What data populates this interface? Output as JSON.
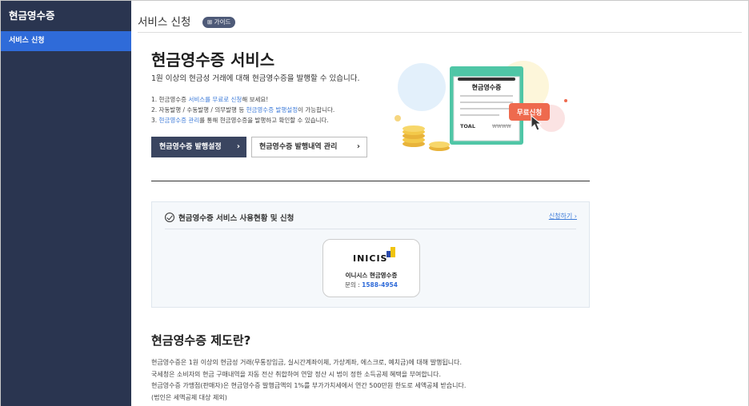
{
  "sidebar": {
    "title": "현금영수증",
    "items": [
      {
        "label": "서비스 신청"
      }
    ]
  },
  "header": {
    "title": "서비스 신청",
    "guide_badge": "⊞ 가이드"
  },
  "hero": {
    "title": "현금영수증 서비스",
    "subtitle": "1원 이상의 현금성 거래에 대해 현금영수증을 발행할 수 있습니다.",
    "lines": [
      {
        "pre": "1. 현금영수증 ",
        "hl": "서비스를 무료로 신청",
        "post": "해 보세요!"
      },
      {
        "pre": "2. 자동발행 / 수동발행 / 의무발행 등 ",
        "hl": "현금영수증 발행설정",
        "post": "이 가능합니다."
      },
      {
        "pre": "3. ",
        "hl": "현금영수증 관리",
        "post": "를 통해 현금영수증을 발행하고 확인할 수 있습니다."
      }
    ],
    "btn_primary": "현금영수증 발행설정",
    "btn_secondary": "현금영수증 발행내역 관리",
    "chevron": "›"
  },
  "illustration": {
    "receipt_title": "현금영수증",
    "total_label": "TOAL",
    "total_value": "₩₩₩₩",
    "badge": "무료신청"
  },
  "status": {
    "heading": "현금영수증 서비스 사용현황 및 신청",
    "apply_link": "신청하기 ›",
    "card": {
      "logo": "INICIS",
      "name": "이니시스 현금영수증",
      "phone_label": "문의 : ",
      "phone": "1588-4954"
    }
  },
  "section": {
    "title": "현금영수증 제도란?",
    "lines": [
      "현금영수증은 1원 이상의 현금성 거래(무통장입금, 실시간계좌이체, 가상계좌, 에스크로, 예치금)에 대해 발행됩니다.",
      "국세청은 소비자의 현금 구매내역을 자동 전산 취합하여 연말 정산 시 법이 정한 소득공제 혜택을 부여합니다.",
      "현금영수증 가맹점(판매자)은 현금영수증 발행금액의 1%를 부가가치세에서 연간 500만원 한도로 세액공제 받습니다.",
      "(법인은 세액공제 대상 제외)"
    ]
  },
  "colors": {
    "sidebar_bg": "#2a3550",
    "sidebar_active": "#2f6bd9",
    "accent_link": "#3d7bd9",
    "badge_red": "#ee6a4e",
    "receipt_green": "#4fc6a6"
  }
}
